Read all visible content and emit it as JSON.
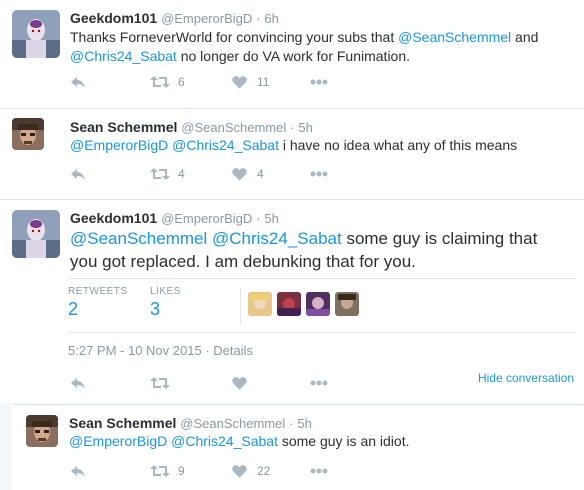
{
  "tweets": [
    {
      "name": "Geekdom101",
      "handle": "@EmperorBigD",
      "time": "6h",
      "text_parts": [
        "Thanks ForneverWorld for convincing your subs that ",
        "@SeanSchemmel",
        " and ",
        "@Chris24_Sabat",
        " no longer do VA work for Funimation."
      ],
      "retweets": "6",
      "likes": "11"
    },
    {
      "name": "Sean Schemmel",
      "handle": "@SeanSchemmel",
      "time": "5h",
      "text_parts": [
        "@EmperorBigD",
        " ",
        "@Chris24_Sabat",
        " i have no idea what any of this means"
      ],
      "retweets": "4",
      "likes": "4"
    },
    {
      "name": "Geekdom101",
      "handle": "@EmperorBigD",
      "time": "5h",
      "text_parts": [
        "@SeanSchemmel",
        " ",
        "@Chris24_Sabat",
        " some guy is claiming that you got replaced. I am debunking that for you."
      ],
      "stats": {
        "retweets_label": "RETWEETS",
        "retweets_value": "2",
        "likes_label": "LIKES",
        "likes_value": "3"
      },
      "timestamp": "5:27 PM - 10 Nov 2015",
      "details_label": "Details",
      "hide_conversation": "Hide conversation"
    },
    {
      "name": "Sean Schemmel",
      "handle": "@SeanSchemmel",
      "time": "5h",
      "text_parts": [
        "@EmperorBigD",
        " ",
        "@Chris24_Sabat",
        " some guy is an idiot."
      ],
      "retweets": "9",
      "likes": "22"
    }
  ],
  "separator": "·",
  "colors": {
    "mention": "#1b95e0",
    "muted": "#8899a6",
    "icon": "#aab8c2",
    "divider": "#e1e8ed"
  },
  "icons": [
    "reply-icon",
    "retweet-icon",
    "heart-icon",
    "more-icon"
  ]
}
